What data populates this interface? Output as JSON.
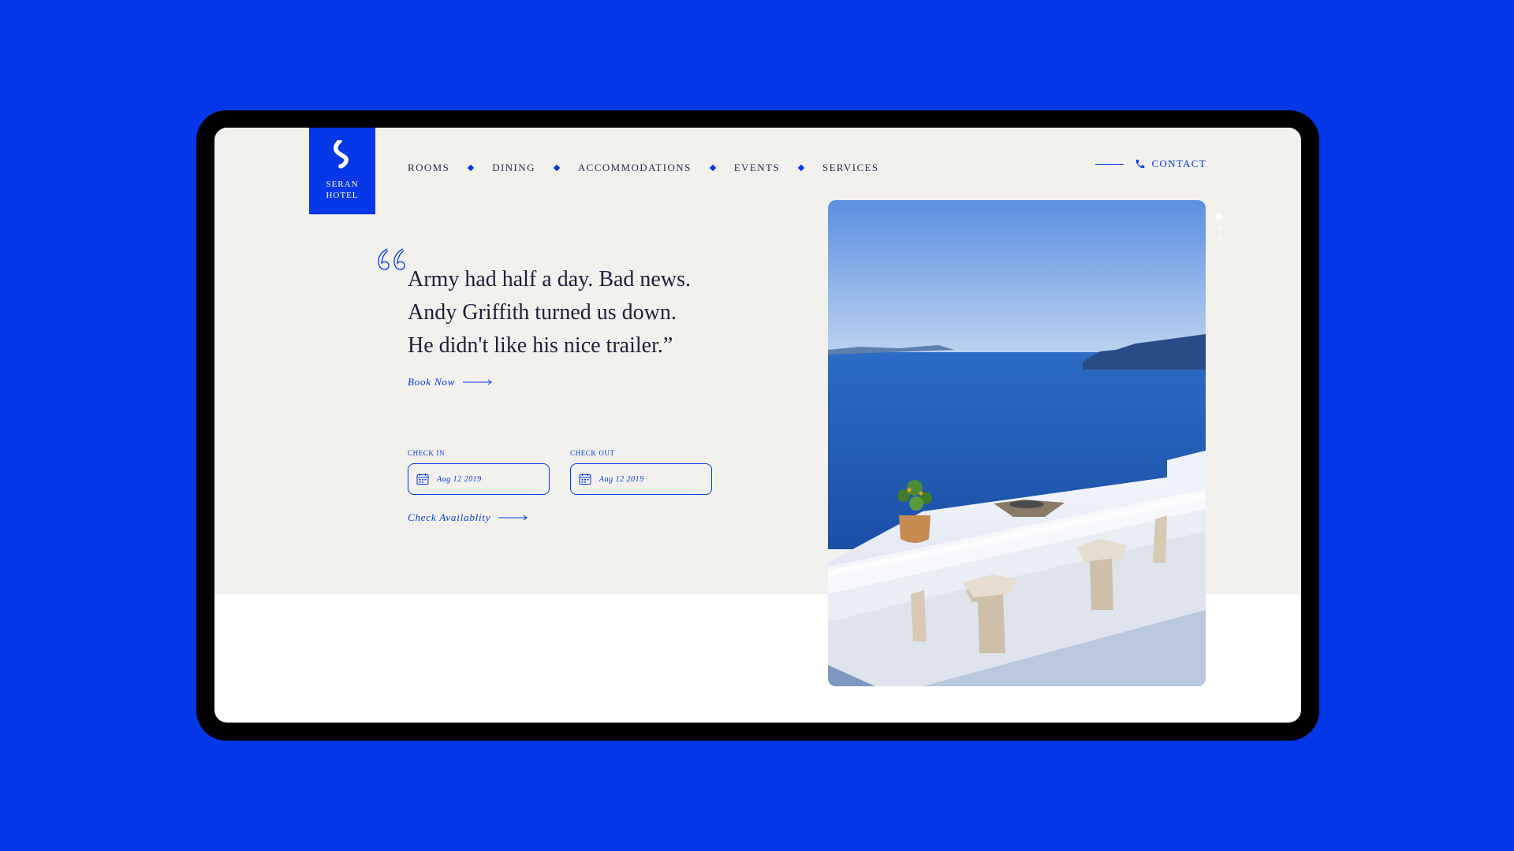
{
  "brand": {
    "name_line1": "SERAN",
    "name_line2": "HOTEL"
  },
  "nav": {
    "items": [
      {
        "label": "ROOMS"
      },
      {
        "label": "DINING"
      },
      {
        "label": "ACCOMMODATIONS"
      },
      {
        "label": "EVENTS"
      },
      {
        "label": "SERVICES"
      }
    ]
  },
  "contact": {
    "label": "CONTACT",
    "icon": "phone-icon"
  },
  "hero": {
    "quote_lines": [
      "Army had half a day. Bad news.",
      "Andy Griffith turned us down.",
      "He didn't like his nice trailer.”"
    ],
    "book_now": "Book Now"
  },
  "booking": {
    "check_in_label": "CHECK IN",
    "check_in_value": "Aug 12 2019",
    "check_out_label": "CHECK OUT",
    "check_out_value": "Aug 12 2019",
    "check_availability": "Check Availablity"
  },
  "colors": {
    "accent": "#0337e8",
    "background": "#0337e8",
    "hero_bg": "#f2f1ee",
    "text_dark": "#1d1f3a"
  },
  "slider": {
    "total": 3,
    "active": 1
  }
}
